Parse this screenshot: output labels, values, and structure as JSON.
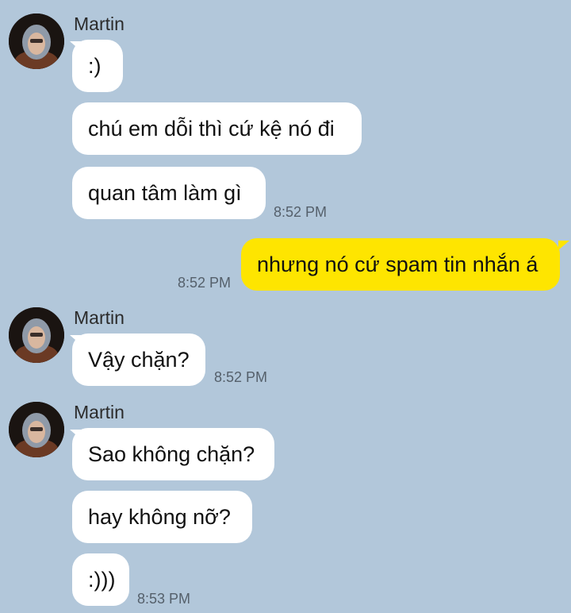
{
  "messages": [
    {
      "sender": "Martin",
      "text": ":)"
    },
    {
      "text": "chú em dỗi thì cứ kệ nó đi"
    },
    {
      "text": "quan tâm làm gì",
      "time": "8:52 PM"
    },
    {
      "text": "nhưng nó cứ spam tin nhắn á",
      "time": "8:52 PM",
      "outgoing": true
    },
    {
      "sender": "Martin",
      "text": "Vậy chặn?",
      "time": "8:52 PM"
    },
    {
      "sender": "Martin",
      "text": "Sao không chặn?"
    },
    {
      "text": "hay không nỡ?"
    },
    {
      "text": ":)))",
      "time": "8:53 PM"
    }
  ],
  "colors": {
    "background": "#b2c7da",
    "incoming_bubble": "#ffffff",
    "outgoing_bubble": "#fee500"
  },
  "icons": {
    "avatar": "avatar-photo-icon"
  }
}
